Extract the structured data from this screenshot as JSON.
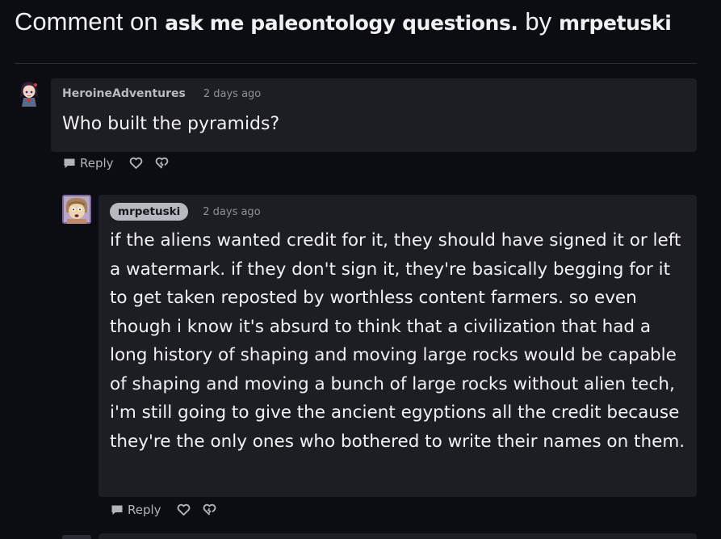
{
  "header": {
    "prefix": "Comment on",
    "post_title": "ask me paleontology questions.",
    "by": "by",
    "post_author": "mrpetuski"
  },
  "comments": [
    {
      "author": "HeroineAdventures",
      "time": "2 days ago",
      "text": "Who built the pyramids?",
      "avatar_icon": "anime-girl-avatar-icon",
      "actions": {
        "reply": "Reply",
        "like_icon": "heart-icon",
        "dislike_icon": "broken-heart-icon"
      }
    },
    {
      "author": "mrpetuski",
      "time": "2 days ago",
      "text": "if the aliens wanted credit for it, they should have signed it or left a watermark. if they don't sign it, they're basically begging for it to get taken reposted by worthless content farmers. so even though i know it's absurd to think that a civilization that had a long history of shaping and moving large rocks would be capable of shaping and moving a bunch of large rocks without alien tech, i'm still going to give the ancient egyptions all the credit because they're the only ones who bothered to write their names on them.",
      "avatar_icon": "cartoon-face-avatar-icon",
      "actions": {
        "reply": "Reply",
        "like_icon": "heart-icon",
        "dislike_icon": "broken-heart-icon"
      }
    }
  ],
  "colors": {
    "background": "#0c0d13",
    "card": "#1d1e24",
    "op_badge": "#b8b9c0",
    "text": "#f2f2f4",
    "muted": "#8f9098"
  }
}
